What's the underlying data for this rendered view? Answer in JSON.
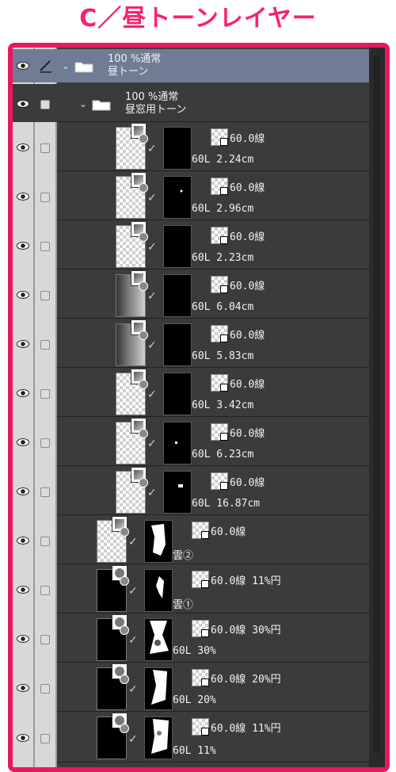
{
  "heading": "C／昼トーンレイヤー",
  "folders": [
    {
      "blend": "100 %通常",
      "name": "昼トーン",
      "selected": true
    },
    {
      "blend": "100 %通常",
      "name": "昼窓用トーン",
      "selected": false
    }
  ],
  "layers": [
    {
      "tone": "60.0線",
      "name": "60L 2.24cm"
    },
    {
      "tone": "60.0線",
      "name": "60L 2.96cm"
    },
    {
      "tone": "60.0線",
      "name": "60L 2.23cm"
    },
    {
      "tone": "60.0線",
      "name": "60L 6.04cm"
    },
    {
      "tone": "60.0線",
      "name": "60L 5.83cm"
    },
    {
      "tone": "60.0線",
      "name": "60L 3.42cm"
    },
    {
      "tone": "60.0線",
      "name": "60L 6.23cm"
    },
    {
      "tone": "60.0線",
      "name": "60L 16.87cm"
    },
    {
      "tone": "60.0線",
      "name": "雲②"
    },
    {
      "tone": "60.0線 11%円",
      "name": "雲①"
    },
    {
      "tone": "60.0線 30%円",
      "name": "60L 30%"
    },
    {
      "tone": "60.0線 20%円",
      "name": "60L 20%"
    },
    {
      "tone": "60.0線 11%円",
      "name": "60L 11%"
    }
  ]
}
